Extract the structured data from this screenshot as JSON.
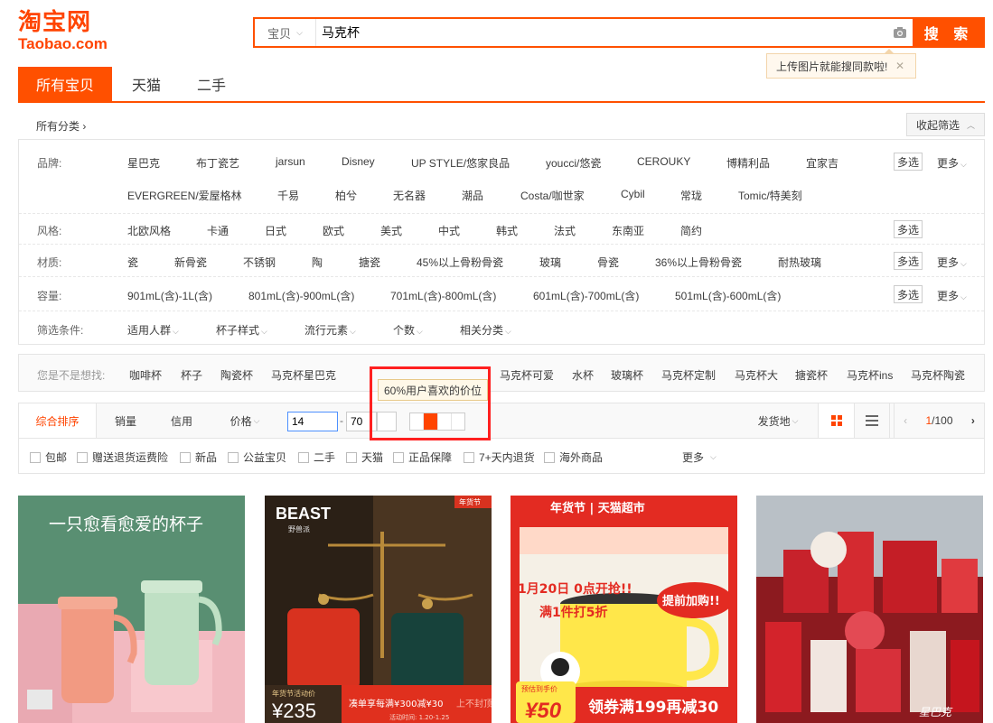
{
  "logo": {
    "cn": "淘宝网",
    "en": "Taobao.com"
  },
  "search": {
    "category": "宝贝",
    "query": "马克杯",
    "button": "搜 索"
  },
  "upload_tip": "上传图片就能搜同款啦!",
  "tabs": [
    "所有宝贝",
    "天猫",
    "二手"
  ],
  "category_bar": {
    "all": "所有分类 ›",
    "collapse": "收起筛选"
  },
  "filters": {
    "brand": {
      "label": "品牌:",
      "row1": [
        "星巴克",
        "布丁瓷艺",
        "jarsun",
        "Disney",
        "UP STYLE/悠家良品",
        "youcci/悠瓷",
        "CEROUKY",
        "博精利品",
        "宜家吉"
      ],
      "row2": [
        "EVERGREEN/爱屋格林",
        "千易",
        "柏兮",
        "无名器",
        "潮品",
        "Costa/咖世家",
        "Cybil",
        "常珑",
        "Tomic/特美刻"
      ]
    },
    "style": {
      "label": "风格:",
      "items": [
        "北欧风格",
        "卡通",
        "日式",
        "欧式",
        "美式",
        "中式",
        "韩式",
        "法式",
        "东南亚",
        "简约"
      ]
    },
    "material": {
      "label": "材质:",
      "items": [
        "瓷",
        "新骨瓷",
        "不锈钢",
        "陶",
        "搪瓷",
        "45%以上骨粉骨瓷",
        "玻璃",
        "骨瓷",
        "36%以上骨粉骨瓷",
        "耐热玻璃"
      ]
    },
    "capacity": {
      "label": "容量:",
      "items": [
        "901mL(含)-1L(含)",
        "801mL(含)-900mL(含)",
        "701mL(含)-800mL(含)",
        "601mL(含)-700mL(含)",
        "501mL(含)-600mL(含)"
      ]
    },
    "conditions": {
      "label": "筛选条件:",
      "items": [
        "适用人群",
        "杯子样式",
        "流行元素",
        "个数",
        "相关分类"
      ]
    },
    "multi": "多选",
    "more": "更多"
  },
  "suggest": {
    "label": "您是不是想找:",
    "items": [
      "咖啡杯",
      "杯子",
      "陶瓷杯",
      "马克杯星巴克",
      "马克杯可爱",
      "水杯",
      "玻璃杯",
      "马克杯定制",
      "马克杯大",
      "搪瓷杯",
      "马克杯ins",
      "马克杯陶瓷"
    ]
  },
  "sort": {
    "items": [
      "综合排序",
      "销量",
      "信用",
      "价格"
    ],
    "price_min": "14",
    "price_max": "70",
    "tooltip": "60%用户喜欢的价位",
    "ship_from": "发货地",
    "page": "1/100"
  },
  "checks": [
    "包邮",
    "赠送退货运费险",
    "新品",
    "公益宝贝",
    "二手",
    "天猫",
    "正品保障",
    "7+天内退货",
    "海外商品"
  ],
  "checks_more": "更多",
  "products": [
    {
      "headline": "一只愈看愈爱的杯子"
    },
    {
      "brand": "BEAST",
      "brand_sub": "野兽派",
      "badge": "年货节",
      "price_label": "年货节活动价",
      "price": "¥235",
      "promo": "凑单享每满¥300减¥30",
      "promo_tail": "上不封顶",
      "date": "活动时间: 1.20-1.25"
    },
    {
      "banner": "年货节 | 天猫超市",
      "sale": "1月20日 0点开抢!!",
      "discount": "满1件打5折",
      "bubble": "提前加购!!",
      "pre_label": "预估到手价",
      "pre_price": "¥50",
      "coupon": "领券满199再减30"
    },
    {
      "watermark": "星巴克"
    }
  ]
}
